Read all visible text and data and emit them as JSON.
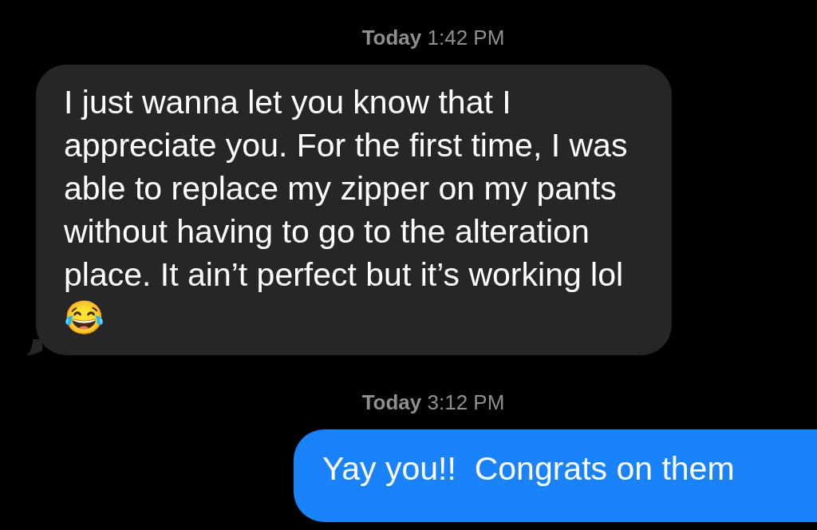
{
  "messages": [
    {
      "kind": "timestamp",
      "text": "**Today** 1:42 PM"
    },
    {
      "kind": "received",
      "text": "I just wanna let you know that I appreciate you. For the first time, I was able to replace my zipper on my pants without having to go to the alteration place. It ain’t perfect but it’s working lol 😂"
    },
    {
      "kind": "timestamp",
      "text": "**Today** 3:12 PM"
    },
    {
      "kind": "sent",
      "text": "Yay you!!  Congrats on them"
    }
  ]
}
